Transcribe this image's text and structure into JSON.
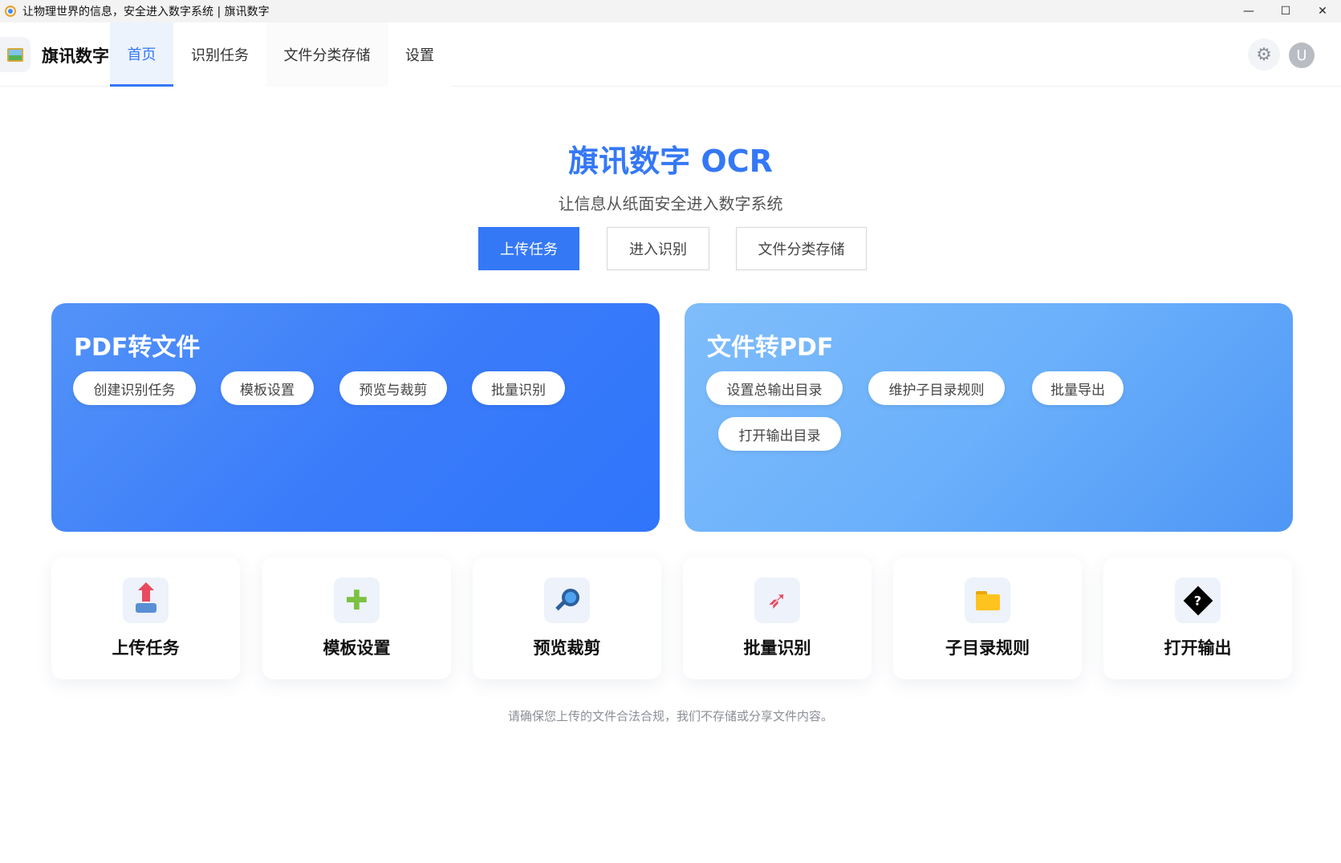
{
  "window": {
    "title": "让物理世界的信息，安全进入数字系统 | 旗讯数字",
    "minimize_glyph": "—",
    "maximize_glyph": "☐",
    "close_glyph": "✕"
  },
  "nav": {
    "brand": "旗讯数字",
    "tabs": [
      {
        "label": "首页",
        "active": true
      },
      {
        "label": "识别任务",
        "active": false
      },
      {
        "label": "文件分类存储",
        "active": false
      },
      {
        "label": "设置",
        "active": false
      }
    ],
    "avatar_letter": "U",
    "settings_icon": "gear-icon"
  },
  "hero": {
    "title": "旗讯数字 OCR",
    "subtitle": "让信息从纸面安全进入数字系统",
    "buttons": [
      "上传任务",
      "进入识别",
      "文件分类存储"
    ]
  },
  "cards": [
    {
      "title": "PDF转文件",
      "pills": [
        "创建识别任务",
        "模板设置",
        "预览与裁剪",
        "批量识别"
      ]
    },
    {
      "title": "文件转PDF",
      "pills": [
        "设置总输出目录",
        "维护子目录规则",
        "批量导出",
        "打开输出目录"
      ]
    }
  ],
  "tiles": [
    {
      "label": "上传任务",
      "icon": "inbox-upload-icon"
    },
    {
      "label": "模板设置",
      "icon": "puzzle-icon"
    },
    {
      "label": "预览裁剪",
      "icon": "magnifier-icon"
    },
    {
      "label": "批量识别",
      "icon": "rocket-icon"
    },
    {
      "label": "子目录规则",
      "icon": "folder-icon"
    },
    {
      "label": "打开输出",
      "icon": "unknown-glyph-icon"
    }
  ],
  "footer": {
    "note": "请确保您上传的文件合法合规，我们不存储或分享文件内容。"
  },
  "colors": {
    "accent": "#3478f6",
    "card1": "#3a7bfa",
    "card2": "#6ab0fb"
  }
}
